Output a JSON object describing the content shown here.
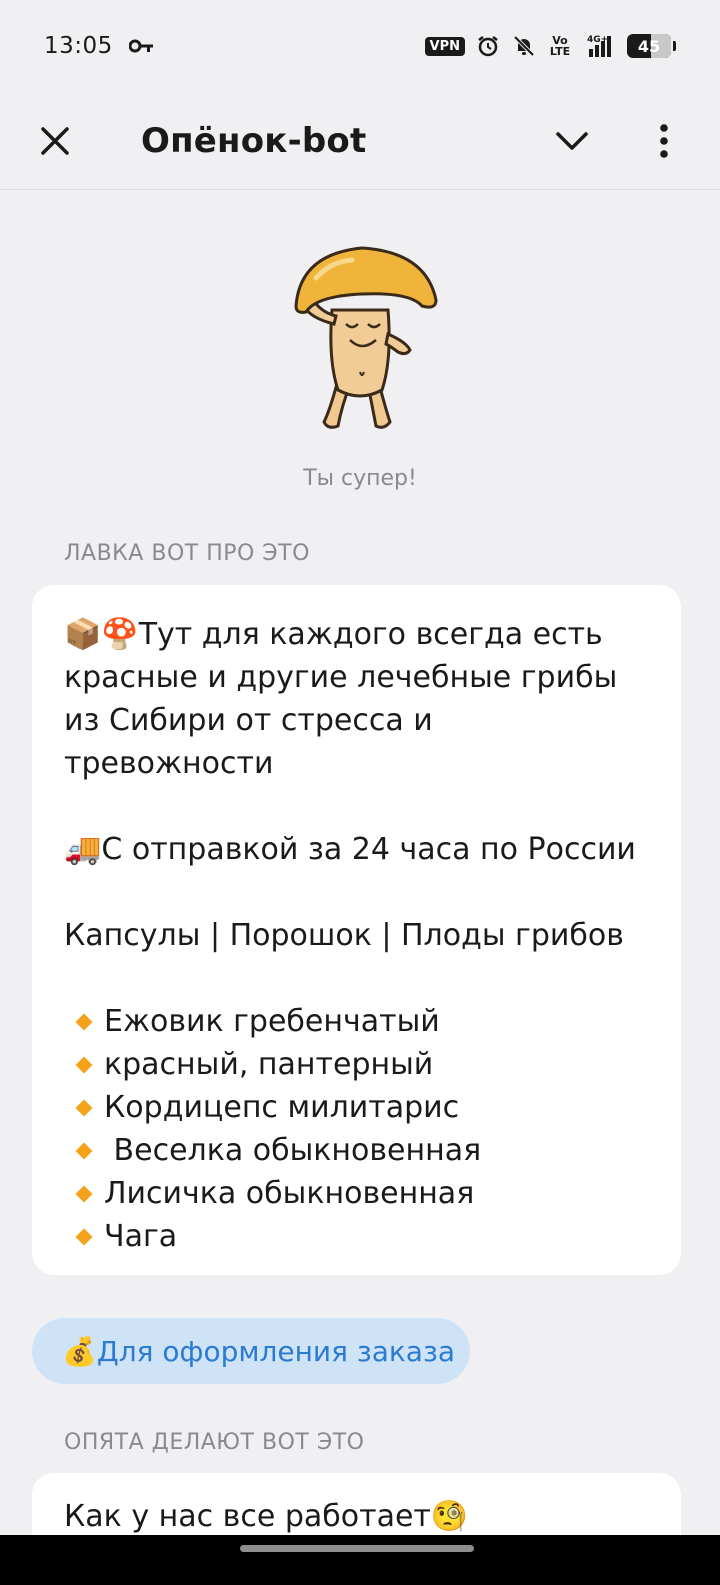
{
  "status_bar": {
    "time": "13:05",
    "vpn": "VPN",
    "volte": "Vo\nLTE",
    "network": "4G+",
    "battery": "45",
    "icons": [
      "key-icon",
      "alarm-icon",
      "bell-off-icon",
      "signal-icon",
      "battery-icon"
    ]
  },
  "header": {
    "title": "Опёнок-bot"
  },
  "sticker": {
    "caption": "Ты супер!"
  },
  "section1": {
    "label": "ЛАВКА ВОТ ПРО ЭТО",
    "intro": "📦🍄Тут для каждого всегда есть красные и другие лечебные грибы из Сибири от стресса и тревожности",
    "delivery": "🚚С отправкой за 24 часа по России",
    "forms": "Капсулы | Порошок | Плоды грибов",
    "items": [
      "Ежовик гребенчатый",
      "красный, пантерный",
      "Кордицепс милитарис",
      " Веселка обыкновенная",
      "Лисичка обыкновенная",
      "Чага"
    ]
  },
  "order_button": {
    "label": "💰Для оформления заказа"
  },
  "section2": {
    "label": "ОПЯТА ДЕЛАЮТ ВОТ ЭТО",
    "text": "Как у нас все работает🧐"
  },
  "colors": {
    "background": "#f0f0f3",
    "card": "#ffffff",
    "accent": "#2a7bd1",
    "button_bg": "#cfe3f6",
    "bullet": "#f4a21a"
  }
}
